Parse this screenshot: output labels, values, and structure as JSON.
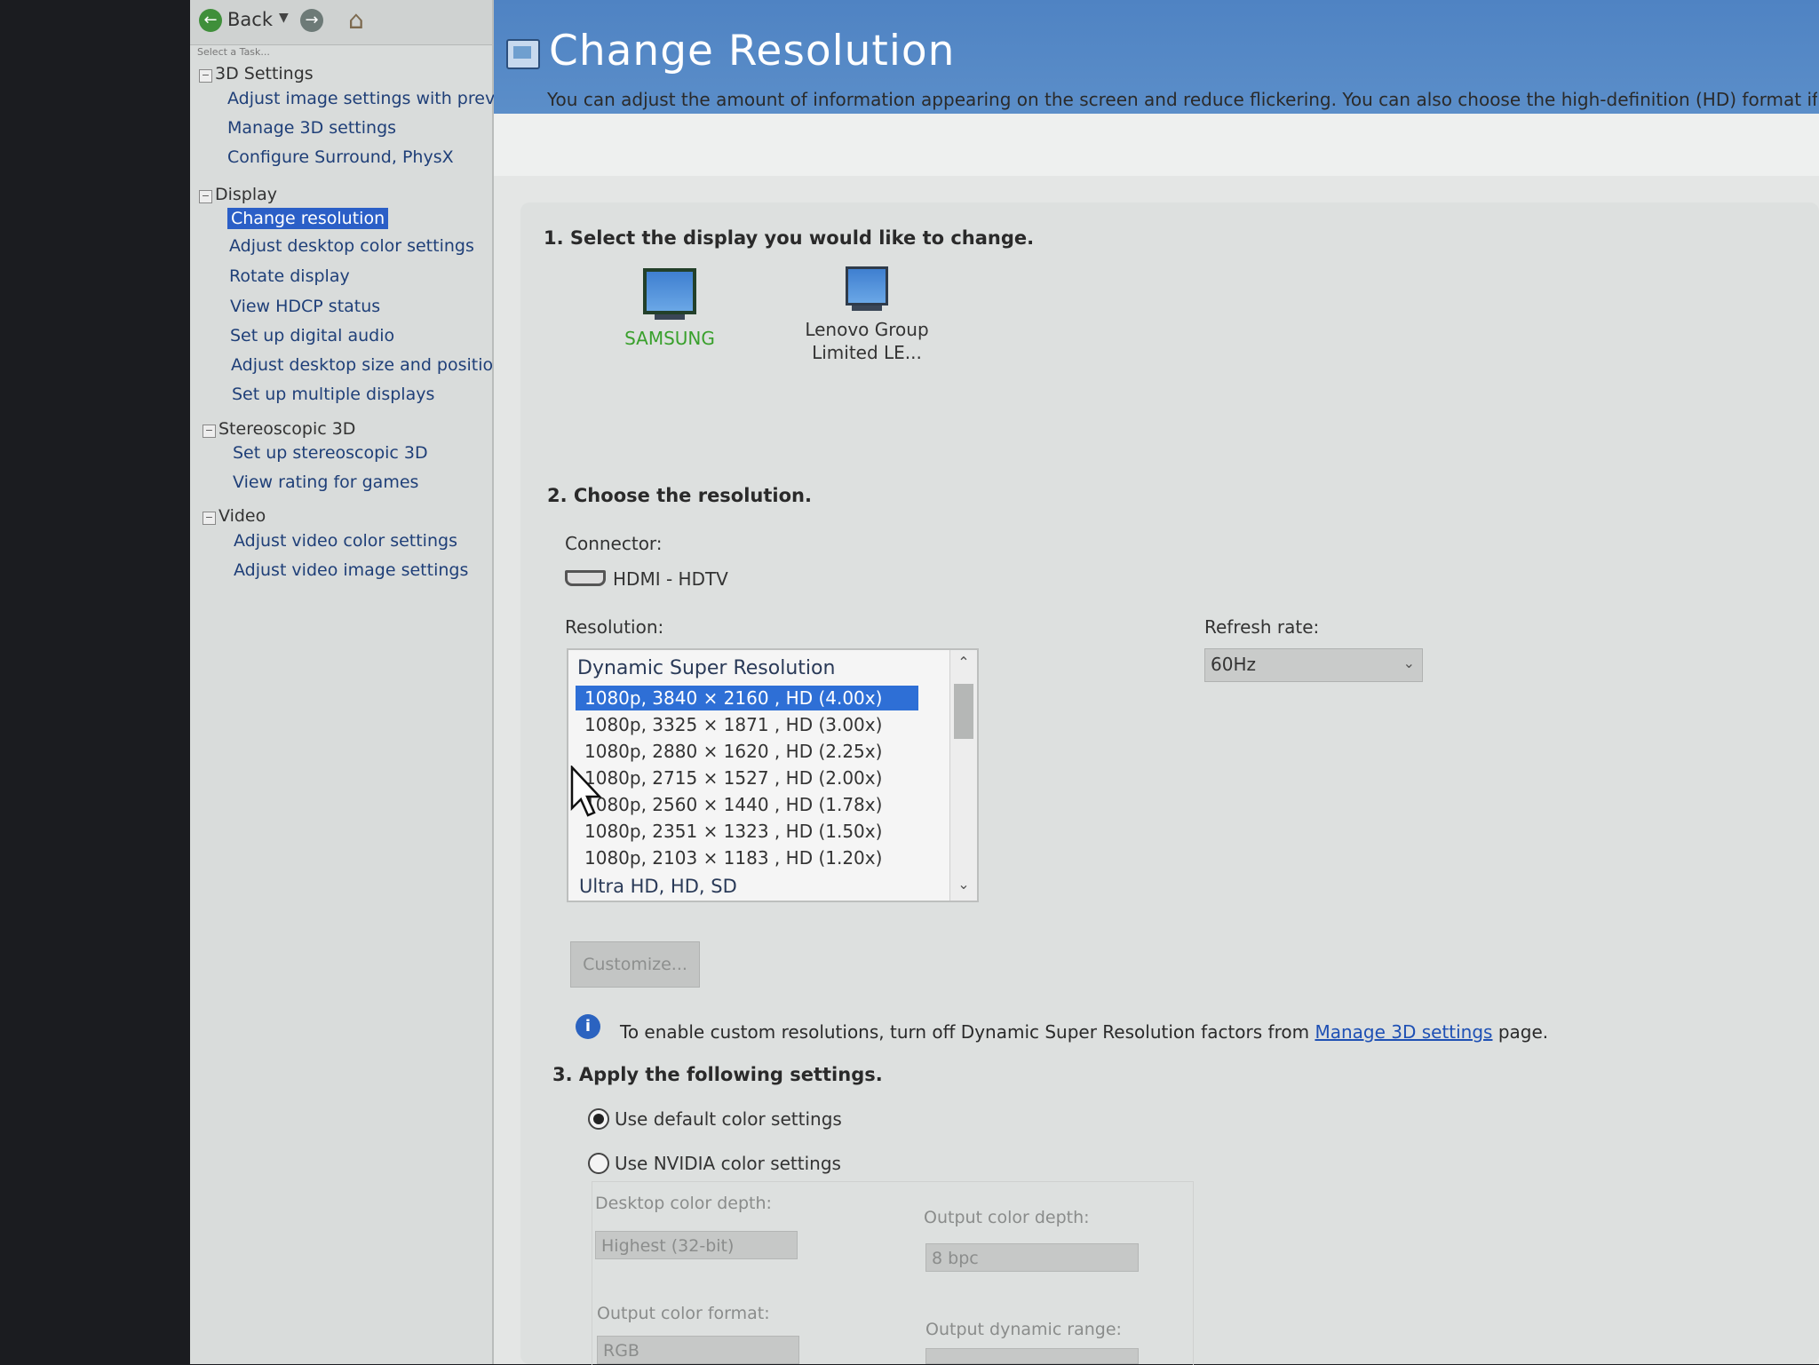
{
  "toolbar": {
    "back_label": "Back",
    "task_hint": "Select a Task..."
  },
  "sidebar": {
    "categories": [
      {
        "label": "3D Settings",
        "items": [
          "Adjust image settings with preview",
          "Manage 3D settings",
          "Configure Surround, PhysX"
        ]
      },
      {
        "label": "Display",
        "items": [
          "Change resolution",
          "Adjust desktop color settings",
          "Rotate display",
          "View HDCP status",
          "Set up digital audio",
          "Adjust desktop size and position",
          "Set up multiple displays"
        ]
      },
      {
        "label": "Stereoscopic 3D",
        "items": [
          "Set up stereoscopic 3D",
          "View rating for games"
        ]
      },
      {
        "label": "Video",
        "items": [
          "Adjust video color settings",
          "Adjust video image settings"
        ]
      }
    ],
    "selected_item": "Change resolution"
  },
  "main": {
    "title": "Change Resolution",
    "intro": "You can adjust the amount of information appearing on the screen and reduce flickering. You can also choose the high-definition (HD) format if yo",
    "step1": {
      "label": "1. Select the display you would like to change.",
      "displays": [
        {
          "name": "SAMSUNG",
          "selected": true
        },
        {
          "name_line1": "Lenovo Group",
          "name_line2": "Limited LE...",
          "selected": false
        }
      ]
    },
    "step2": {
      "label": "2. Choose the resolution.",
      "connector_label": "Connector:",
      "connector_value": "HDMI - HDTV",
      "resolution_label": "Resolution:",
      "resolution_group_header": "Dynamic Super Resolution",
      "resolutions": [
        "1080p, 3840 × 2160 , HD (4.00x)",
        "1080p, 3325 × 1871 , HD (3.00x)",
        "1080p, 2880 × 1620 , HD (2.25x)",
        "1080p, 2715 × 1527 , HD (2.00x)",
        "1080p, 2560 × 1440 , HD (1.78x)",
        "1080p, 2351 × 1323 , HD (1.50x)",
        "1080p, 2103 × 1183 , HD (1.20x)"
      ],
      "selected_resolution_index": 0,
      "next_group_header": "Ultra HD, HD, SD",
      "refresh_label": "Refresh rate:",
      "refresh_value": "60Hz",
      "customize_label": "Customize...",
      "info_text_before": "To enable custom resolutions, turn off Dynamic Super Resolution factors from",
      "info_link": "Manage 3D settings",
      "info_text_after": "page."
    },
    "step3": {
      "label": "3. Apply the following settings.",
      "option_default": "Use default color settings",
      "option_nvidia": "Use NVIDIA color settings",
      "selected_option": "default",
      "desktop_depth_label": "Desktop color depth:",
      "desktop_depth_value": "Highest (32-bit)",
      "output_depth_label": "Output color depth:",
      "output_depth_value": "8 bpc",
      "output_format_label": "Output color format:",
      "output_format_value": "RGB",
      "output_range_label": "Output dynamic range:"
    }
  },
  "colors": {
    "banner": "#4f83c3",
    "selection": "#2e6fd6",
    "link": "#1e50b4",
    "samsung_label": "#39a02c"
  }
}
